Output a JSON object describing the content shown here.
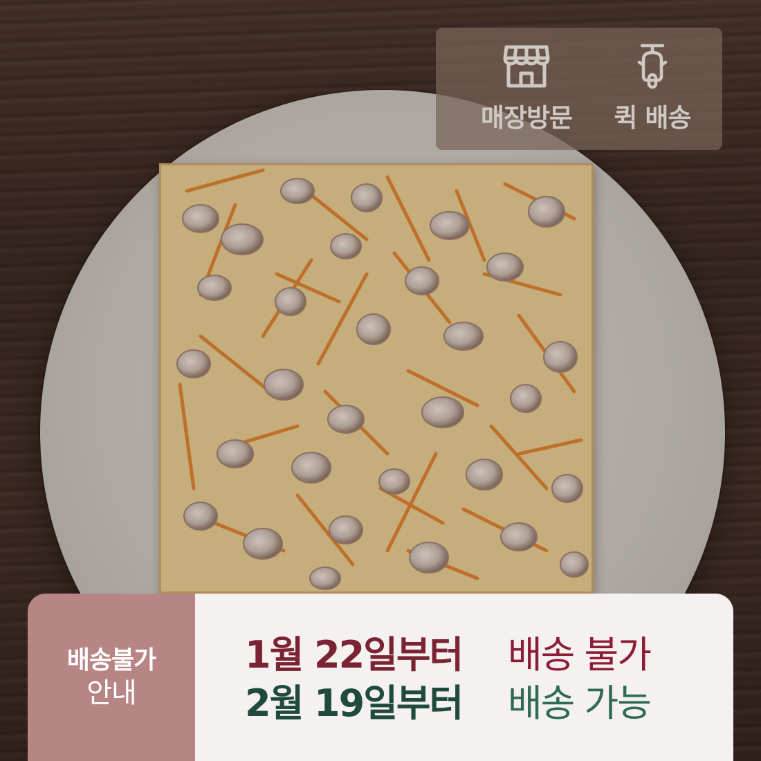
{
  "badge": {
    "store_visit": {
      "label": "매장방문",
      "icon": "store-icon"
    },
    "quick_delivery": {
      "label": "퀵 배송",
      "icon": "scooter-icon"
    }
  },
  "notice": {
    "title_line1": "배송불가",
    "title_line2": "안내",
    "lines": [
      {
        "date": "1월 22일부터",
        "status": "배송 불가"
      },
      {
        "date": "2월 19일부터",
        "status": "배송 가능"
      }
    ]
  },
  "colors": {
    "notice_left_bg": "#b88585",
    "unavailable": "#8e1c36",
    "available": "#2e6a54"
  }
}
